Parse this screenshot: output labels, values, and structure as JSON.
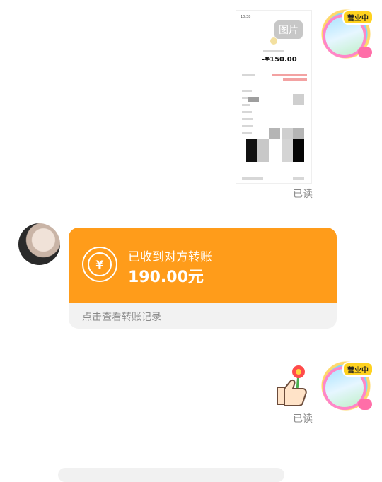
{
  "messages": {
    "top": {
      "image_tag": "图片",
      "thumbnail_amount": "-¥150.00",
      "read_status": "已读"
    },
    "transfer": {
      "title": "已收到对方转账",
      "amount": "190.00元",
      "footer": "点击查看转账记录",
      "icon": "yen-refresh-icon",
      "color": "#ff9c1a"
    },
    "bottom": {
      "sticker": "thumbs-up-flower-sticker",
      "read_status": "已读"
    }
  },
  "avatars": {
    "right_badge": "营业中"
  }
}
